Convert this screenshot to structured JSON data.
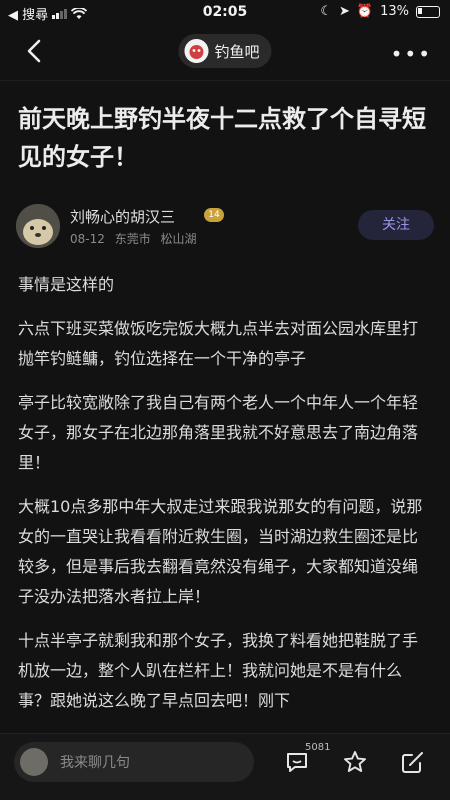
{
  "status_bar": {
    "carrier": "◀ 搜尋",
    "time": "02:05",
    "battery": "13%"
  },
  "nav": {
    "forum_name": "钓鱼吧",
    "more": "•••"
  },
  "post": {
    "title": "前天晚上野钓半夜十二点救了个自寻短见的女子！",
    "author": {
      "name": "刘畅心的胡汉三",
      "level": "14",
      "date": "08-12",
      "location": "东莞市 松山湖",
      "follow_label": "关注"
    },
    "paragraphs": [
      "事情是这样的",
      "六点下班买菜做饭吃完饭大概九点半去对面公园水库里打抛竿钓鲢鳙，钓位选择在一个干净的亭子",
      "亭子比较宽敞除了我自己有两个老人一个中年人一个年轻女子，那女子在北边那角落里我就不好意思去了南边角落里！",
      "大概10点多那中年大叔走过来跟我说那女的有问题，说那女的一直哭让我看看附近救生圈，当时湖边救生圈还是比较多，但是事后我去翻看竟然没有绳子，大家都知道没绳子没办法把落水者拉上岸！",
      "十点半亭子就剩我和那个女子，我换了料看她把鞋脱了手机放一边，整个人趴在栏杆上！我就问她是不是有什么事？跟她说这么晚了早点回去吧！刚下"
    ]
  },
  "bottom_bar": {
    "reply_placeholder": "我来聊几句",
    "comment_count": "5081"
  }
}
